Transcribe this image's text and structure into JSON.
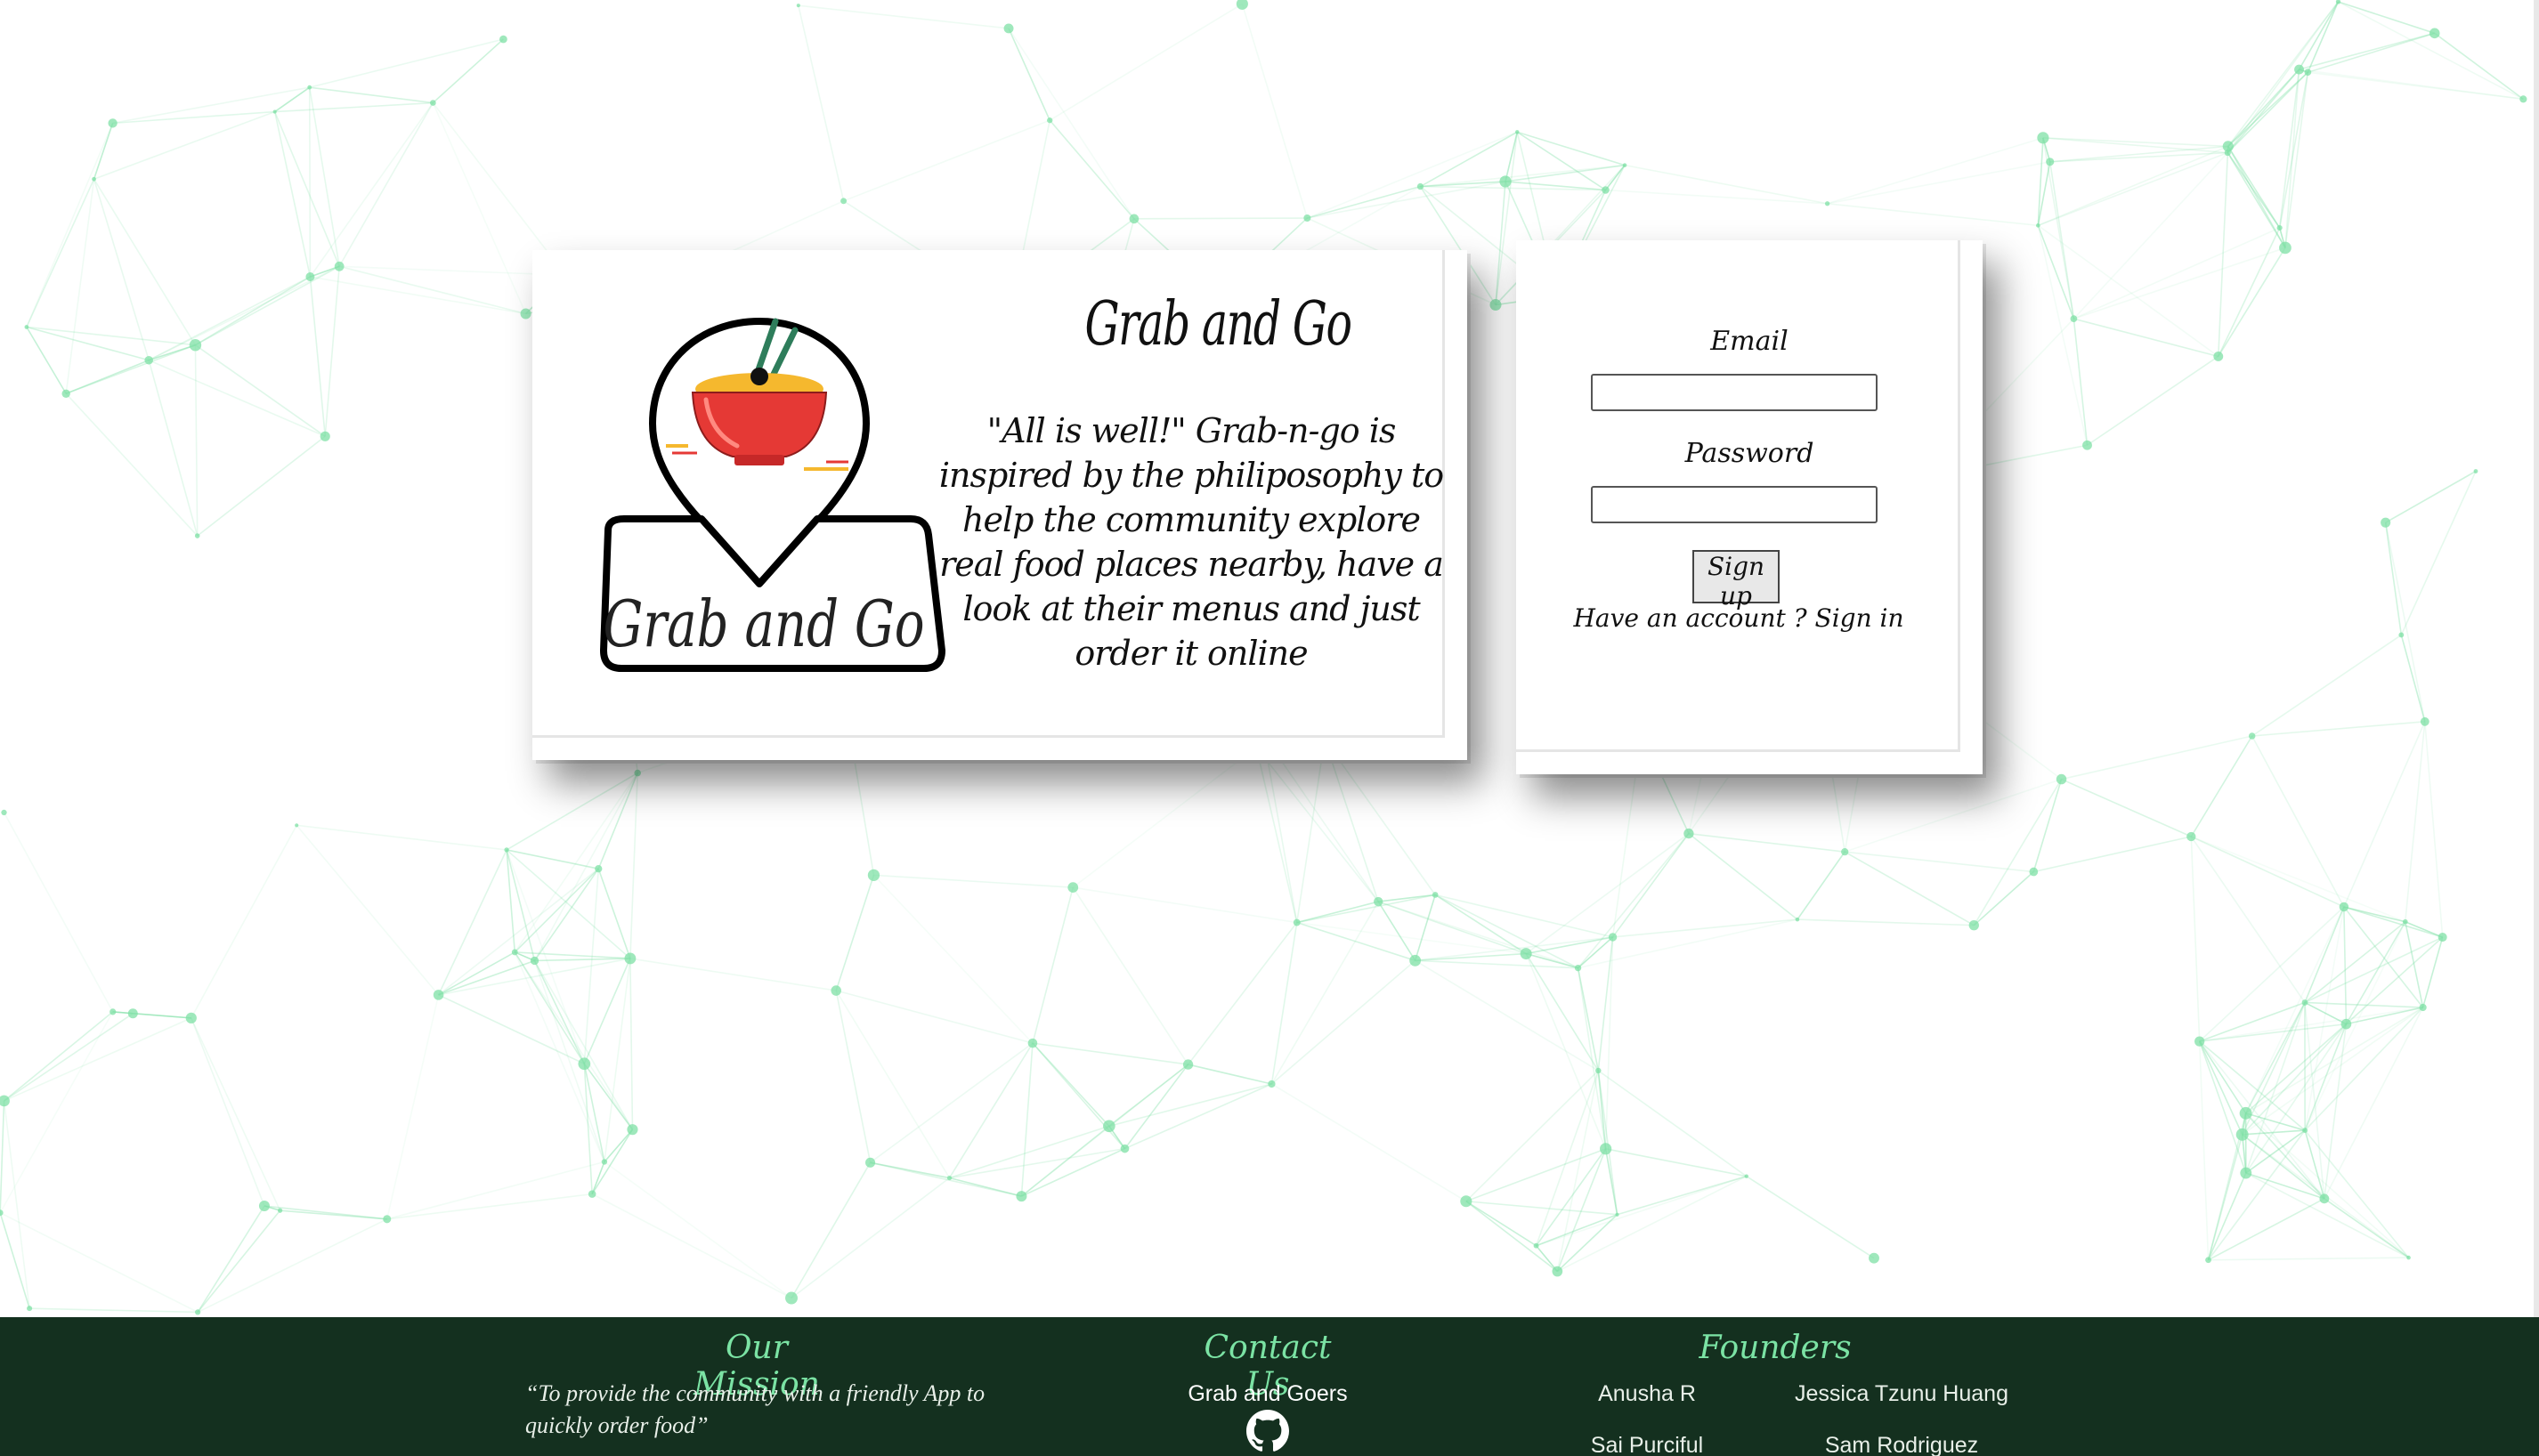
{
  "brand": {
    "title": "Grab and Go",
    "logo_text": "Grab and Go",
    "tagline": "\"All is well!\" Grab-n-go is inspired by the philiposophy to help the community explore real food places nearby, have a look at their menus and just order it online"
  },
  "signup_form": {
    "email_label": "Email",
    "password_label": "Password",
    "email_value": "",
    "password_value": "",
    "submit_label": "Sign up",
    "have_account_text": "Have an account ?",
    "sign_in_link": "Sign in"
  },
  "footer": {
    "mission_heading": "Our Mission",
    "mission_text": "“To provide the community with a friendly App to quickly order food”",
    "contact_heading": "Contact Us",
    "contact_name": "Grab and Goers",
    "contact_icon": "github-icon",
    "founders_heading": "Founders",
    "founders": [
      "Anusha R",
      "Jessica Tzunu Huang",
      "Sai Purciful",
      "Sam Rodriguez"
    ]
  },
  "colors": {
    "footer_bg": "#14301f",
    "footer_accent": "#7be3a4",
    "network_lines": "#7fe0a6",
    "bowl_red": "#e53935",
    "noodle_yellow": "#f5b82e",
    "chopsticks_green": "#2e7d5b"
  }
}
